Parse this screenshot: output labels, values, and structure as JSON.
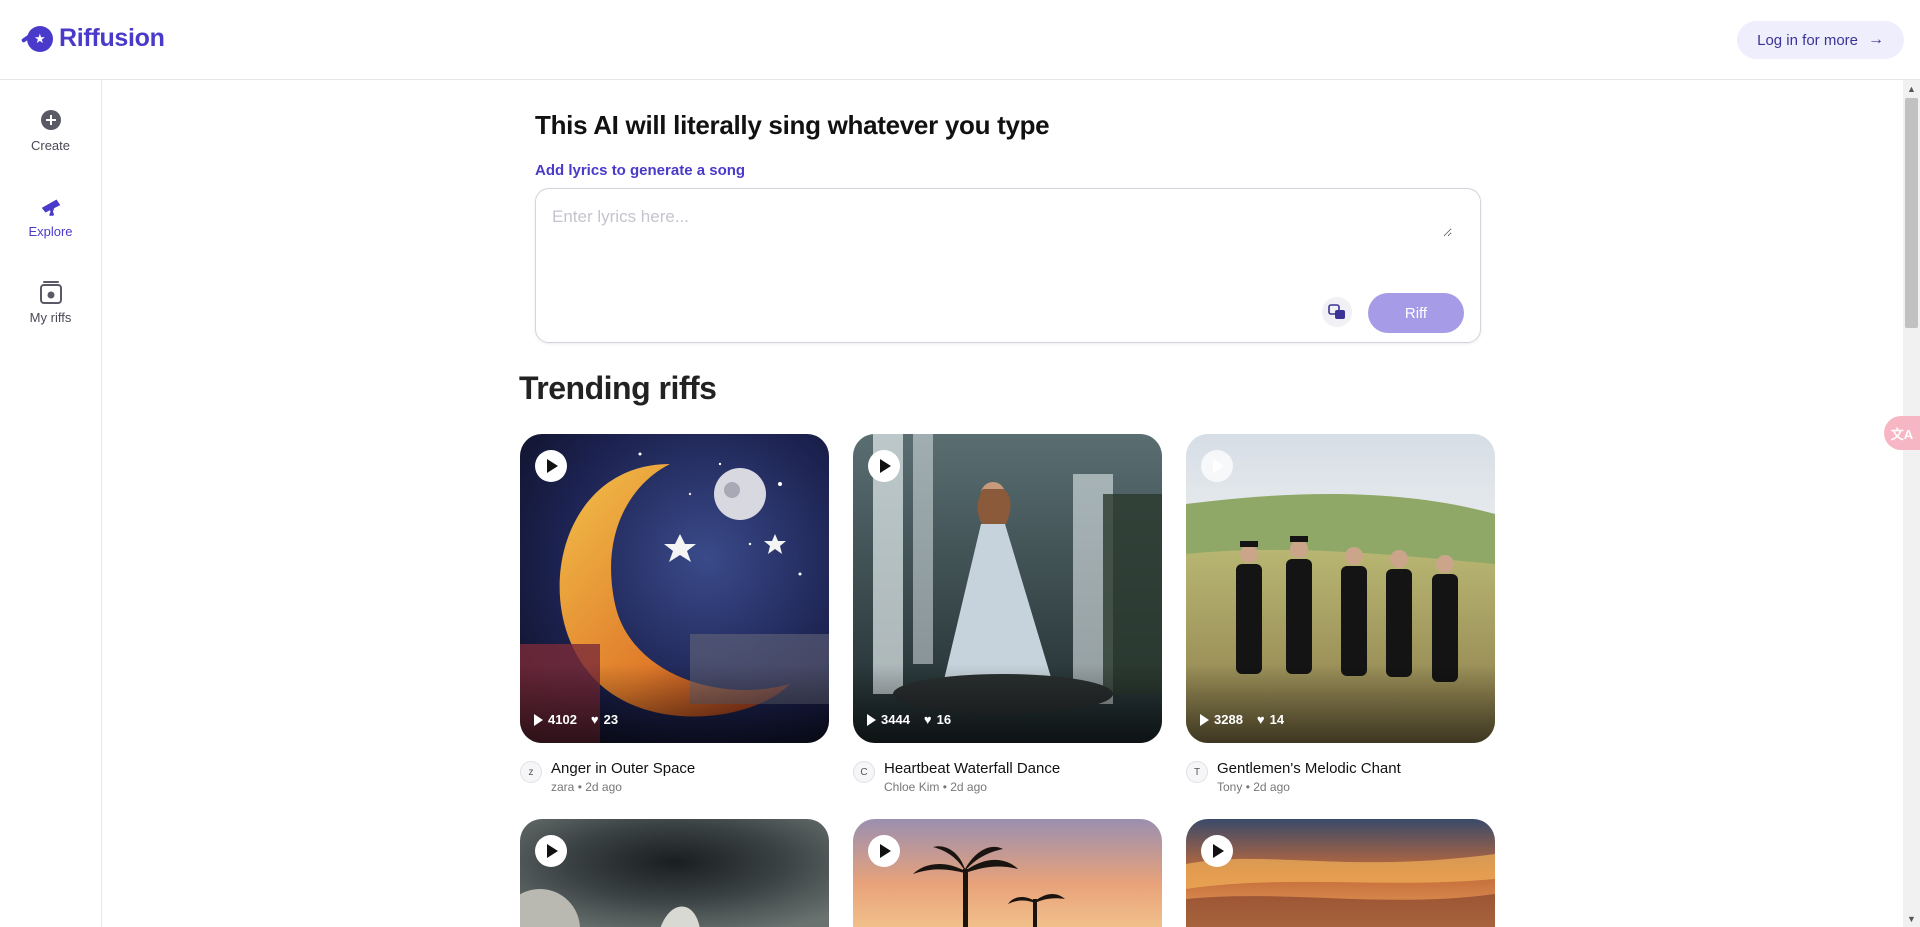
{
  "app": {
    "name": "Riffusion",
    "login_label": "Log in for more",
    "accent": "#4a3ac9"
  },
  "sidebar": {
    "items": [
      {
        "label": "Create",
        "icon": "plus-circle-icon",
        "active": false
      },
      {
        "label": "Explore",
        "icon": "telescope-icon",
        "active": true
      },
      {
        "label": "My riffs",
        "icon": "library-icon",
        "active": false
      }
    ]
  },
  "compose": {
    "heading": "This AI will literally sing whatever you type",
    "prompt_label": "Add lyrics to generate a song",
    "placeholder": "Enter lyrics here...",
    "value": "",
    "riff_label": "Riff",
    "lang_icon": "translate-icon"
  },
  "trending": {
    "title": "Trending riffs",
    "cards": [
      {
        "title": "Anger in Outer Space",
        "author": "zara",
        "initial": "z",
        "age": "2d ago",
        "plays": "4102",
        "likes": "23"
      },
      {
        "title": "Heartbeat Waterfall Dance",
        "author": "Chloe Kim",
        "initial": "C",
        "age": "2d ago",
        "plays": "3444",
        "likes": "16"
      },
      {
        "title": "Gentlemen's Melodic Chant",
        "author": "Tony",
        "initial": "T",
        "age": "2d ago",
        "plays": "3288",
        "likes": "14"
      },
      {
        "title": "",
        "author": "",
        "initial": "",
        "age": "",
        "plays": "",
        "likes": ""
      },
      {
        "title": "",
        "author": "",
        "initial": "",
        "age": "",
        "plays": "",
        "likes": ""
      },
      {
        "title": "",
        "author": "",
        "initial": "",
        "age": "",
        "plays": "",
        "likes": ""
      }
    ]
  },
  "meta_separator": "•"
}
